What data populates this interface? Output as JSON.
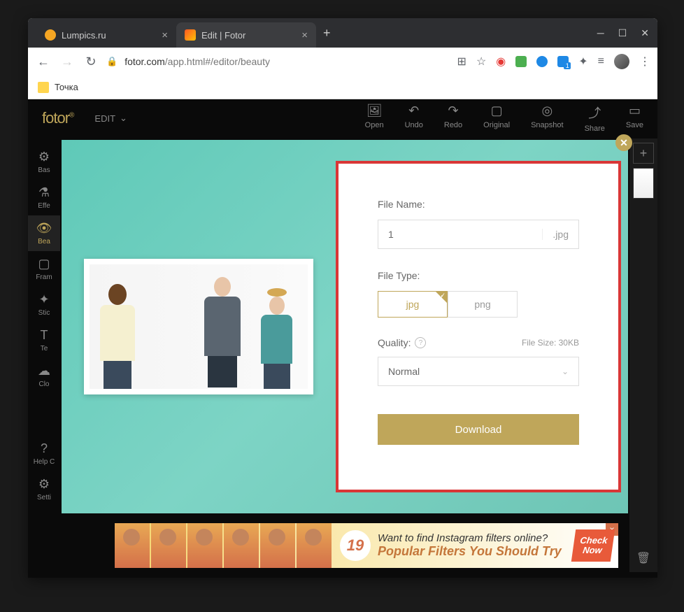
{
  "tabs": [
    {
      "title": "Lumpics.ru",
      "icon_color": "#f5a623"
    },
    {
      "title": "Edit | Fotor",
      "icon_color": "#ff5722"
    }
  ],
  "url": {
    "domain": "fotor.com",
    "path": "/app.html#/editor/beauty"
  },
  "bookmark": "Точка",
  "logo": "fotor",
  "edit_menu": "EDIT",
  "top_tools": [
    {
      "label": "Open"
    },
    {
      "label": "Undo"
    },
    {
      "label": "Redo"
    },
    {
      "label": "Original"
    },
    {
      "label": "Snapshot"
    },
    {
      "label": "Share"
    },
    {
      "label": "Save"
    }
  ],
  "left_tools": [
    {
      "label": "Bas"
    },
    {
      "label": "Effe"
    },
    {
      "label": "Bea"
    },
    {
      "label": "Fram"
    },
    {
      "label": "Stic"
    },
    {
      "label": "Te"
    },
    {
      "label": "Clo"
    },
    {
      "label": "Help C"
    },
    {
      "label": "Setti"
    }
  ],
  "save": {
    "filename_label": "File Name:",
    "filename_value": "1",
    "ext": ".jpg",
    "filetype_label": "File Type:",
    "type_jpg": "jpg",
    "type_png": "png",
    "quality_label": "Quality:",
    "filesize": "File Size: 30KB",
    "quality_value": "Normal",
    "download": "Download"
  },
  "banner": {
    "number": "19",
    "line1": "Want to find Instagram filters online?",
    "line2": "Popular Filters You Should Try",
    "cta1": "Check",
    "cta2": "Now"
  }
}
